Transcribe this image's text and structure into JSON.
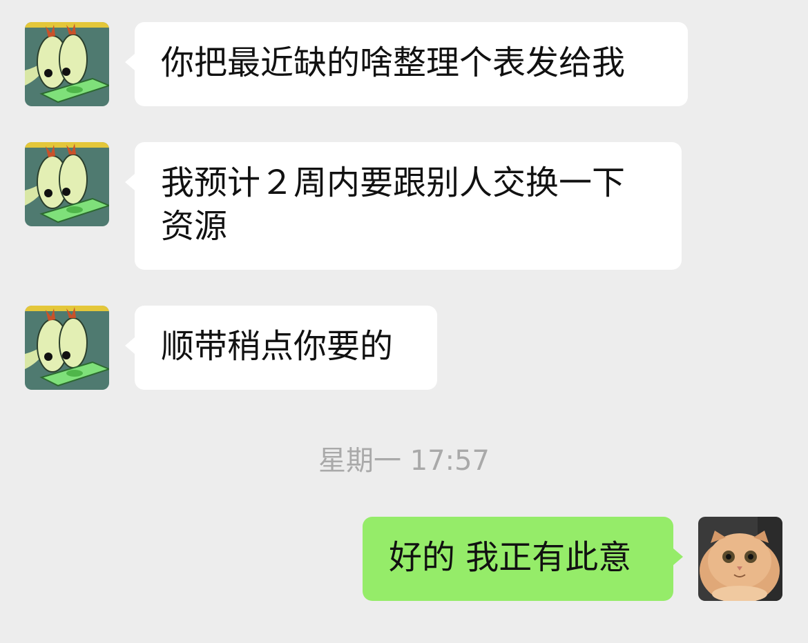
{
  "messages": [
    {
      "sender": "other",
      "avatar_icon": "cartoon-eyes-money-avatar",
      "text": "你把最近缺的啥整理个表发给我"
    },
    {
      "sender": "other",
      "avatar_icon": "cartoon-eyes-money-avatar",
      "text": "我预计２周内要跟别人交换一下资源"
    },
    {
      "sender": "other",
      "avatar_icon": "cartoon-eyes-money-avatar",
      "text": "顺带稍点你要的"
    },
    {
      "sender": "self",
      "avatar_icon": "cat-avatar",
      "text": "好的 我正有此意"
    }
  ],
  "timestamp": "星期一 17:57",
  "colors": {
    "background": "#ededed",
    "incoming_bubble": "#ffffff",
    "outgoing_bubble": "#95ec69",
    "timestamp_text": "#a9a9a9"
  }
}
